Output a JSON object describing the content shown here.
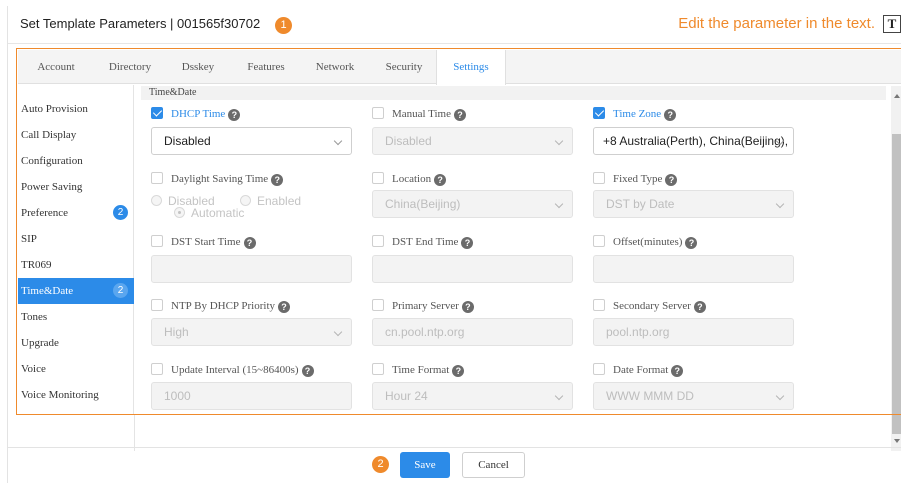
{
  "header": {
    "title": "Set Template Parameters | 001565f30702",
    "step1_badge": "1",
    "hint": "Edit the parameter in the text.",
    "text_mode_icon": "T"
  },
  "tabs": [
    {
      "label": "Account"
    },
    {
      "label": "Directory"
    },
    {
      "label": "Dsskey"
    },
    {
      "label": "Features"
    },
    {
      "label": "Network"
    },
    {
      "label": "Security"
    },
    {
      "label": "Settings",
      "active": true
    }
  ],
  "sidebar": {
    "items": [
      {
        "label": "Auto Provision"
      },
      {
        "label": "Call Display"
      },
      {
        "label": "Configuration"
      },
      {
        "label": "Power Saving"
      },
      {
        "label": "Preference",
        "badge": "2"
      },
      {
        "label": "SIP"
      },
      {
        "label": "TR069"
      },
      {
        "label": "Time&Date",
        "badge": "2",
        "active": true
      },
      {
        "label": "Tones"
      },
      {
        "label": "Upgrade"
      },
      {
        "label": "Voice"
      },
      {
        "label": "Voice Monitoring"
      }
    ]
  },
  "section": {
    "title": "Time&Date"
  },
  "fields": {
    "dhcp_time": {
      "label": "DHCP Time",
      "checked": true,
      "value": "Disabled"
    },
    "manual_time": {
      "label": "Manual Time",
      "checked": false,
      "value": "Disabled"
    },
    "time_zone": {
      "label": "Time Zone",
      "checked": true,
      "value": "+8 Australia(Perth), China(Beijing),"
    },
    "daylight_saving": {
      "label": "Daylight Saving Time",
      "checked": false,
      "options": [
        "Disabled",
        "Enabled",
        "Automatic"
      ],
      "selected": "Automatic"
    },
    "location": {
      "label": "Location",
      "checked": false,
      "value": "China(Beijing)"
    },
    "fixed_type": {
      "label": "Fixed Type",
      "checked": false,
      "value": "DST by Date"
    },
    "dst_start": {
      "label": "DST Start Time",
      "checked": false,
      "value": ""
    },
    "dst_end": {
      "label": "DST End Time",
      "checked": false,
      "value": ""
    },
    "offset": {
      "label": "Offset(minutes)",
      "checked": false,
      "value": ""
    },
    "ntp_priority": {
      "label": "NTP By DHCP Priority",
      "checked": false,
      "value": "High"
    },
    "primary_server": {
      "label": "Primary Server",
      "checked": false,
      "value": "cn.pool.ntp.org"
    },
    "secondary_server": {
      "label": "Secondary Server",
      "checked": false,
      "value": "pool.ntp.org"
    },
    "update_interval": {
      "label": "Update Interval (15~86400s)",
      "checked": false,
      "value": "1000"
    },
    "time_format": {
      "label": "Time Format",
      "checked": false,
      "value": "Hour 24"
    },
    "date_format": {
      "label": "Date Format",
      "checked": false,
      "value": "WWW MMM DD"
    }
  },
  "help_icon": "?",
  "footer": {
    "step2_badge": "2",
    "save_label": "Save",
    "cancel_label": "Cancel"
  },
  "colors": {
    "accent": "#2c8be8",
    "annotation": "#ef8a2c"
  }
}
